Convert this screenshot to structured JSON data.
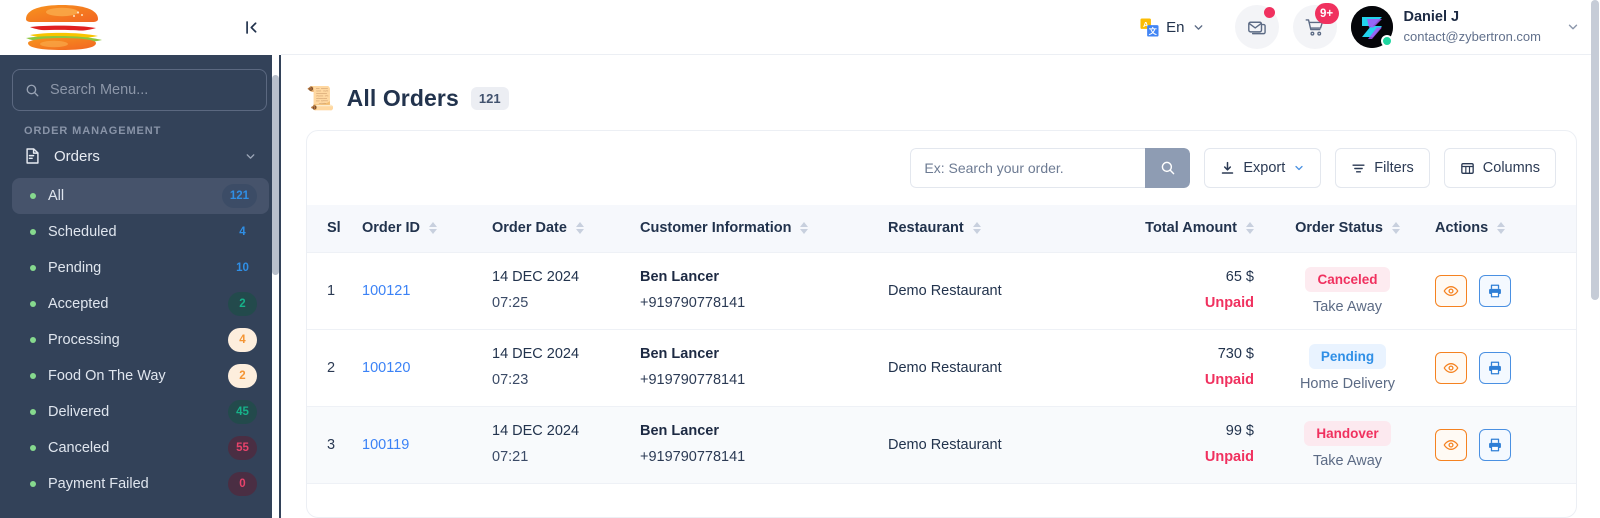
{
  "sidebar": {
    "logo_name": "burger-logo",
    "collapse_icon": "collapse-left-icon",
    "search": {
      "placeholder": "Search Menu...",
      "value": "",
      "icon": "search-icon"
    },
    "section_label": "ORDER MANAGEMENT",
    "group": {
      "label": "Orders",
      "icon": "orders-document-icon",
      "chevron": "chevron-down-icon"
    },
    "items": [
      {
        "label": "All",
        "count": "121",
        "badge_style": "b-blue",
        "active": true
      },
      {
        "label": "Scheduled",
        "count": "4",
        "badge_style": "b-plain",
        "active": false
      },
      {
        "label": "Pending",
        "count": "10",
        "badge_style": "b-plain",
        "active": false
      },
      {
        "label": "Accepted",
        "count": "2",
        "badge_style": "b-green",
        "active": false
      },
      {
        "label": "Processing",
        "count": "4",
        "badge_style": "b-orange",
        "active": false
      },
      {
        "label": "Food On The Way",
        "count": "2",
        "badge_style": "b-orange",
        "active": false
      },
      {
        "label": "Delivered",
        "count": "45",
        "badge_style": "b-green",
        "active": false
      },
      {
        "label": "Canceled",
        "count": "55",
        "badge_style": "b-red",
        "active": false
      },
      {
        "label": "Payment Failed",
        "count": "0",
        "badge_style": "b-red",
        "active": false
      }
    ]
  },
  "topbar": {
    "language": {
      "label": "En",
      "icon": "translate-icon",
      "chevron": "chevron-down-icon"
    },
    "mail": {
      "icon": "envelope-icon",
      "has_dot": true
    },
    "cart": {
      "icon": "cart-icon",
      "count": "9+"
    },
    "user": {
      "name": "Daniel J",
      "email": "contact@zybertron.com",
      "avatar_icon": "z-logo-avatar",
      "status": "online",
      "chevron": "chevron-down-icon"
    }
  },
  "page": {
    "icon": "receipt-icon",
    "title": "All Orders",
    "count": "121"
  },
  "toolbar": {
    "search": {
      "placeholder": "Ex: Search your order.",
      "value": "",
      "button_icon": "search-icon"
    },
    "export": {
      "label": "Export",
      "icon": "download-icon",
      "chevron": "chevron-down-icon"
    },
    "filters": {
      "label": "Filters",
      "icon": "filter-icon"
    },
    "columns": {
      "label": "Columns",
      "icon": "columns-icon"
    }
  },
  "table": {
    "columns": [
      {
        "label": "Sl",
        "sortable": false
      },
      {
        "label": "Order ID",
        "sortable": true
      },
      {
        "label": "Order Date",
        "sortable": true
      },
      {
        "label": "Customer Information",
        "sortable": true
      },
      {
        "label": "Restaurant",
        "sortable": true
      },
      {
        "label": "Total Amount",
        "sortable": true
      },
      {
        "label": "Order Status",
        "sortable": true
      },
      {
        "label": "Actions",
        "sortable": true
      }
    ],
    "rows": [
      {
        "sl": "1",
        "order_id": "100121",
        "date": "14 DEC 2024",
        "time": "07:25",
        "customer_name": "Ben Lancer",
        "customer_phone": "+919790778141",
        "restaurant": "Demo Restaurant",
        "amount": "65 $",
        "payment": "Unpaid",
        "status": "Canceled",
        "status_style": "canceled",
        "delivery_type": "Take Away",
        "actions": [
          "view-icon",
          "print-icon"
        ]
      },
      {
        "sl": "2",
        "order_id": "100120",
        "date": "14 DEC 2024",
        "time": "07:23",
        "customer_name": "Ben Lancer",
        "customer_phone": "+919790778141",
        "restaurant": "Demo Restaurant",
        "amount": "730 $",
        "payment": "Unpaid",
        "status": "Pending",
        "status_style": "pending",
        "delivery_type": "Home Delivery",
        "actions": [
          "view-icon",
          "print-icon"
        ]
      },
      {
        "sl": "3",
        "order_id": "100119",
        "date": "14 DEC 2024",
        "time": "07:21",
        "customer_name": "Ben Lancer",
        "customer_phone": "+919790778141",
        "restaurant": "Demo Restaurant",
        "amount": "99 $",
        "payment": "Unpaid",
        "status": "Handover",
        "status_style": "handover",
        "delivery_type": "Take Away",
        "actions": [
          "view-icon",
          "print-icon"
        ]
      }
    ]
  },
  "colors": {
    "sidebar_bg": "#334259",
    "sidebar_active": "#46536b",
    "accent_blue": "#3b82f6",
    "danger": "#f0315f",
    "warning": "#f58220",
    "success": "#17b38a",
    "title": "#22334d"
  }
}
